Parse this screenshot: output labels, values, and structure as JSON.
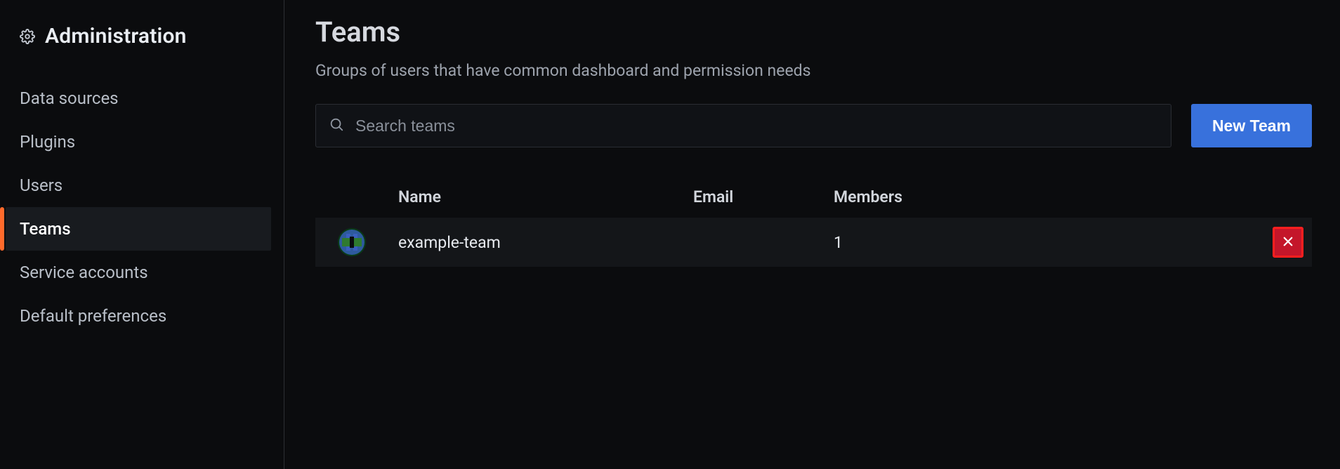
{
  "sidebar": {
    "title": "Administration",
    "items": [
      {
        "label": "Data sources",
        "active": false
      },
      {
        "label": "Plugins",
        "active": false
      },
      {
        "label": "Users",
        "active": false
      },
      {
        "label": "Teams",
        "active": true
      },
      {
        "label": "Service accounts",
        "active": false
      },
      {
        "label": "Default preferences",
        "active": false
      }
    ]
  },
  "page": {
    "title": "Teams",
    "description": "Groups of users that have common dashboard and permission needs"
  },
  "toolbar": {
    "search_placeholder": "Search teams",
    "new_team_label": "New Team"
  },
  "table": {
    "headers": {
      "name": "Name",
      "email": "Email",
      "members": "Members"
    },
    "rows": [
      {
        "name": "example-team",
        "email": "",
        "members": "1"
      }
    ]
  },
  "colors": {
    "accent": "#3871dc",
    "danger": "#c4162a",
    "danger_border": "#ff1f1f",
    "active_indicator": "#ff6a2b"
  }
}
